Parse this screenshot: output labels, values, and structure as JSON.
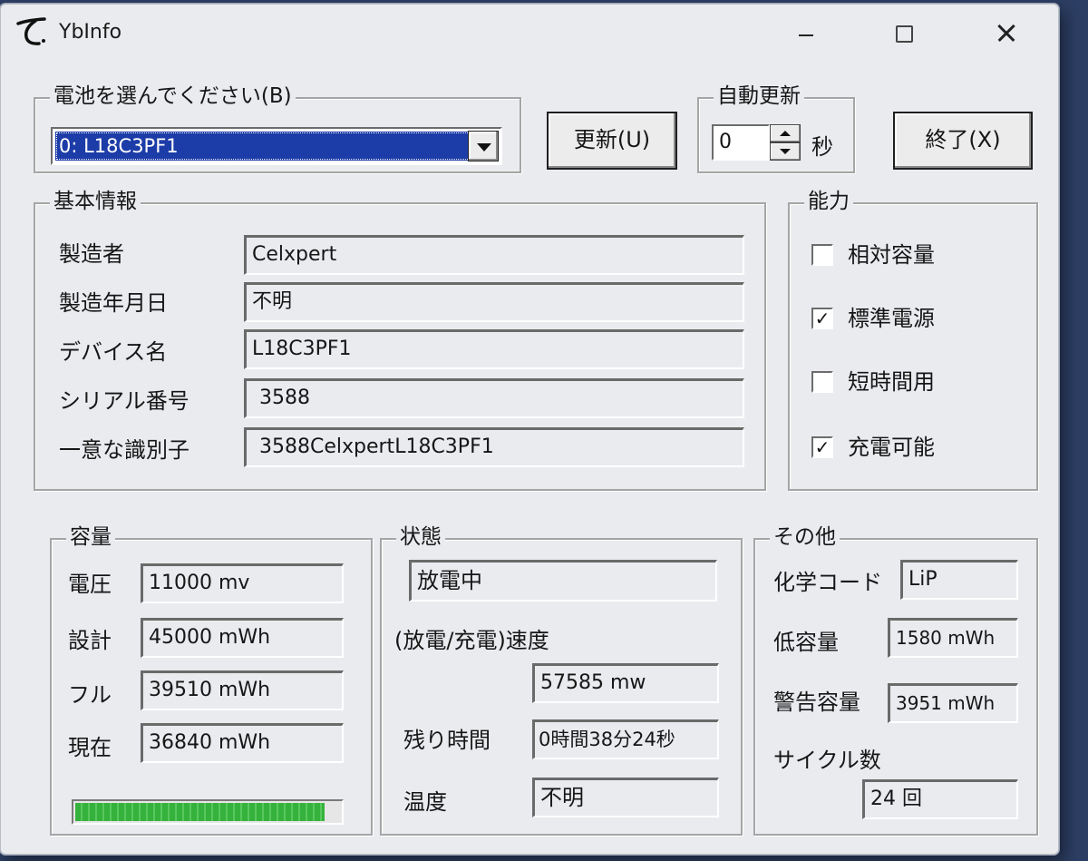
{
  "window": {
    "title": "YbInfo"
  },
  "battery_select": {
    "legend": "電池を選んでください(B)",
    "selected": "0: L18C3PF1"
  },
  "toolbar": {
    "refresh_label": "更新(U)",
    "exit_label": "終了(X)"
  },
  "auto_refresh": {
    "legend": "自動更新",
    "value": "0",
    "unit": "秒"
  },
  "basic_info": {
    "legend": "基本情報",
    "rows": [
      {
        "label": "製造者",
        "value": "Celxpert"
      },
      {
        "label": "製造年月日",
        "value": "不明"
      },
      {
        "label": "デバイス名",
        "value": "L18C3PF1"
      },
      {
        "label": "シリアル番号",
        "value": "3588"
      },
      {
        "label": "一意な識別子",
        "value": "3588CelxpertL18C3PF1"
      }
    ]
  },
  "capabilities": {
    "legend": "能力",
    "items": [
      {
        "label": "相対容量",
        "checked": false,
        "mark": ""
      },
      {
        "label": "標準電源",
        "checked": true,
        "mark": "✓"
      },
      {
        "label": "短時間用",
        "checked": false,
        "mark": ""
      },
      {
        "label": "充電可能",
        "checked": true,
        "mark": "✓"
      }
    ]
  },
  "capacity": {
    "legend": "容量",
    "rows": [
      {
        "label": "電圧",
        "value": "11000 mv"
      },
      {
        "label": "設計",
        "value": "45000 mWh"
      },
      {
        "label": "フル",
        "value": "39510 mWh"
      },
      {
        "label": "現在",
        "value": "36840 mWh"
      }
    ],
    "charge_level": 0.93,
    "bar_color": "#35b23c"
  },
  "status": {
    "legend": "状態",
    "state": "放電中",
    "rate_label": "(放電/充電)速度",
    "rate_value": "57585 mw",
    "remaining_label": "残り時間",
    "remaining_value": "0時間38分24秒",
    "temp_label": "温度",
    "temp_value": "不明"
  },
  "other": {
    "legend": "その他",
    "chem_label": "化学コード",
    "chem_value": "LiP",
    "low_label": "低容量",
    "low_value": "1580 mWh",
    "warn_label": "警告容量",
    "warn_value": "3951 mWh",
    "cycle_label": "サイクル数",
    "cycle_value": "24 回"
  },
  "colors": {
    "selection": "#1c3ca8",
    "dialog_bg": "#e9ebef",
    "desktop": "#2c3e63"
  }
}
